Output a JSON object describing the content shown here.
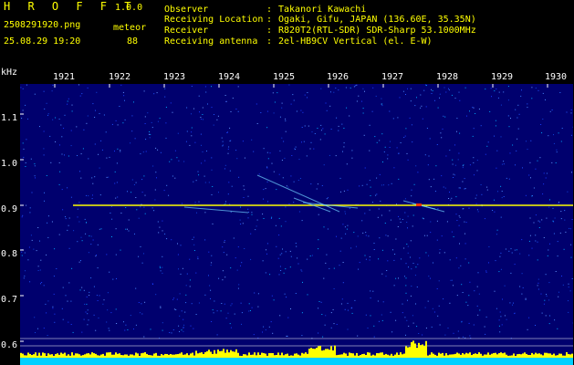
{
  "header": {
    "brand": "H R O F F T",
    "version": "1.0.0",
    "filename": "2508291920.png",
    "datetime": "25.08.29 19:20",
    "mode": "meteor",
    "count": "88"
  },
  "info": [
    {
      "key": "Observer",
      "value": "Takanori Kawachi"
    },
    {
      "key": "Receiving Location",
      "value": "Ogaki, Gifu, JAPAN (136.60E, 35.35N)"
    },
    {
      "key": "Receiver",
      "value": "R820T2(RTL-SDR) SDR-Sharp 53.1000MHz"
    },
    {
      "key": "Receiving antenna",
      "value": "2el-HB9CV Vertical (el. E-W)"
    }
  ],
  "spectrogram": {
    "y_unit": "kHz",
    "y_ticks": [
      "1.1",
      "1.0",
      "0.9",
      "0.8",
      "0.7",
      "0.6"
    ],
    "x_ticks": [
      "1921",
      "1922",
      "1923",
      "1924",
      "1925",
      "1926",
      "1927",
      "1928",
      "1929",
      "1930"
    ],
    "colors": {
      "background": "#00006e",
      "signal": "#ffff00",
      "trace": "#00ffff"
    }
  }
}
